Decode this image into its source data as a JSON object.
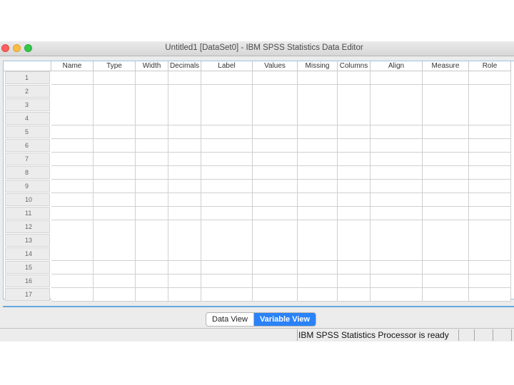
{
  "window": {
    "title": "Untitled1 [DataSet0] - IBM SPSS Statistics Data Editor"
  },
  "grid": {
    "columns": [
      "Name",
      "Type",
      "Width",
      "Decimals",
      "Label",
      "Values",
      "Missing",
      "Columns",
      "Align",
      "Measure",
      "Role"
    ],
    "row_numbers": [
      "1",
      "2",
      "3",
      "4",
      "5",
      "6",
      "7",
      "8",
      "9",
      "10",
      "11",
      "12",
      "13",
      "14",
      "15",
      "16",
      "17"
    ]
  },
  "tabs": {
    "data_view": "Data View",
    "variable_view": "Variable View",
    "active": "variable_view"
  },
  "status": {
    "message": "IBM SPSS Statistics Processor is ready"
  },
  "colors": {
    "accent": "#2a82f7",
    "close": "#fc605c",
    "minimize": "#fdbc40",
    "maximize": "#34c84a"
  }
}
